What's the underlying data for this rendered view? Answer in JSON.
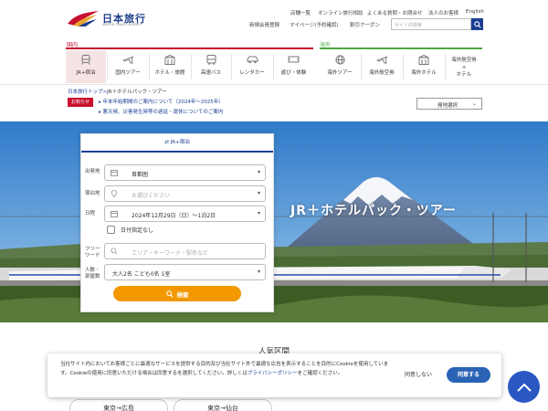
{
  "brand": {
    "name": "日本旅行",
    "tagline": "NIPPON TRAVEL AGENCY"
  },
  "header": {
    "links_top": [
      "店舗一覧",
      "オンライン旅行相談",
      "よくある質問・お問合せ",
      "法人のお客様",
      "English"
    ],
    "links_mid": [
      "新規会員登録",
      "マイページ(予約確認)",
      "割引クーポン"
    ],
    "search_placeholder": "サイト内検索"
  },
  "nav": {
    "domestic_label": "国内",
    "overseas_label": "海外",
    "domestic": [
      {
        "label": "JR+宿泊",
        "icon": "train-icon"
      },
      {
        "label": "国内ツアー",
        "icon": "plane-icon"
      },
      {
        "label": "ホテル・旅館",
        "icon": "hotel-icon"
      },
      {
        "label": "高速バス",
        "icon": "bus-icon"
      },
      {
        "label": "レンタカー",
        "icon": "car-icon"
      },
      {
        "label": "遊び・体験",
        "icon": "ticket-icon"
      }
    ],
    "overseas": [
      {
        "label": "海外ツアー",
        "icon": "globe-icon"
      },
      {
        "label": "海外航空券",
        "icon": "plane-icon"
      },
      {
        "label": "海外ホテル",
        "icon": "hotel-icon"
      },
      {
        "label": "海外航空券\n+\nホテル",
        "icon": ""
      }
    ]
  },
  "breadcrumb": {
    "home": "日本旅行トップ",
    "sep": ">",
    "current": "JR＋ホテルパック・ツアー"
  },
  "notices": {
    "badge": "お知らせ",
    "items": [
      "年末年始期間のご案内について（2024年～2025年）",
      "悪天候、災害発生時等の遅延・運休についてのご案内"
    ]
  },
  "departure_select": "発地選択",
  "hero": {
    "title": "JR＋ホテルパック・ツアー"
  },
  "search_card": {
    "tab": "JR+宿泊",
    "departure_label": "出発地",
    "departure_value": "首都圏",
    "stay_label": "宿泊地",
    "stay_placeholder": "お選びください",
    "date_label": "日程",
    "date_value": "2024年12月29日（日）〜1泊2日",
    "no_date_label": "日付指定なし",
    "keyword_label": "フリー\nワード",
    "keyword_placeholder": "エリア・キーワード・駅名など",
    "people_label": "人数・\n部屋数",
    "people_value": "大人2名  こども0名  1室",
    "search_button": "検索"
  },
  "popular": {
    "title": "人気区間",
    "routes": [
      "東京→広島",
      "東京→仙台"
    ]
  },
  "cookie": {
    "text": "当社サイト内においてお客様ごとに最適なサービスを提供する目的及び当社サイト外で最適な広告を表示することを目的にCookieを使用しています。Cookieの使用に同意いただける場合は同意するを選択してください。詳しくは",
    "link": "プライバシーポリシー",
    "text_end": "をご確認ください。",
    "reject": "同意しない",
    "accept": "同意する"
  },
  "colors": {
    "accent_red": "#c8102e",
    "accent_green": "#4da843",
    "navy": "#1b3f95",
    "orange": "#f39800",
    "cookie_blue": "#2a62b5"
  }
}
